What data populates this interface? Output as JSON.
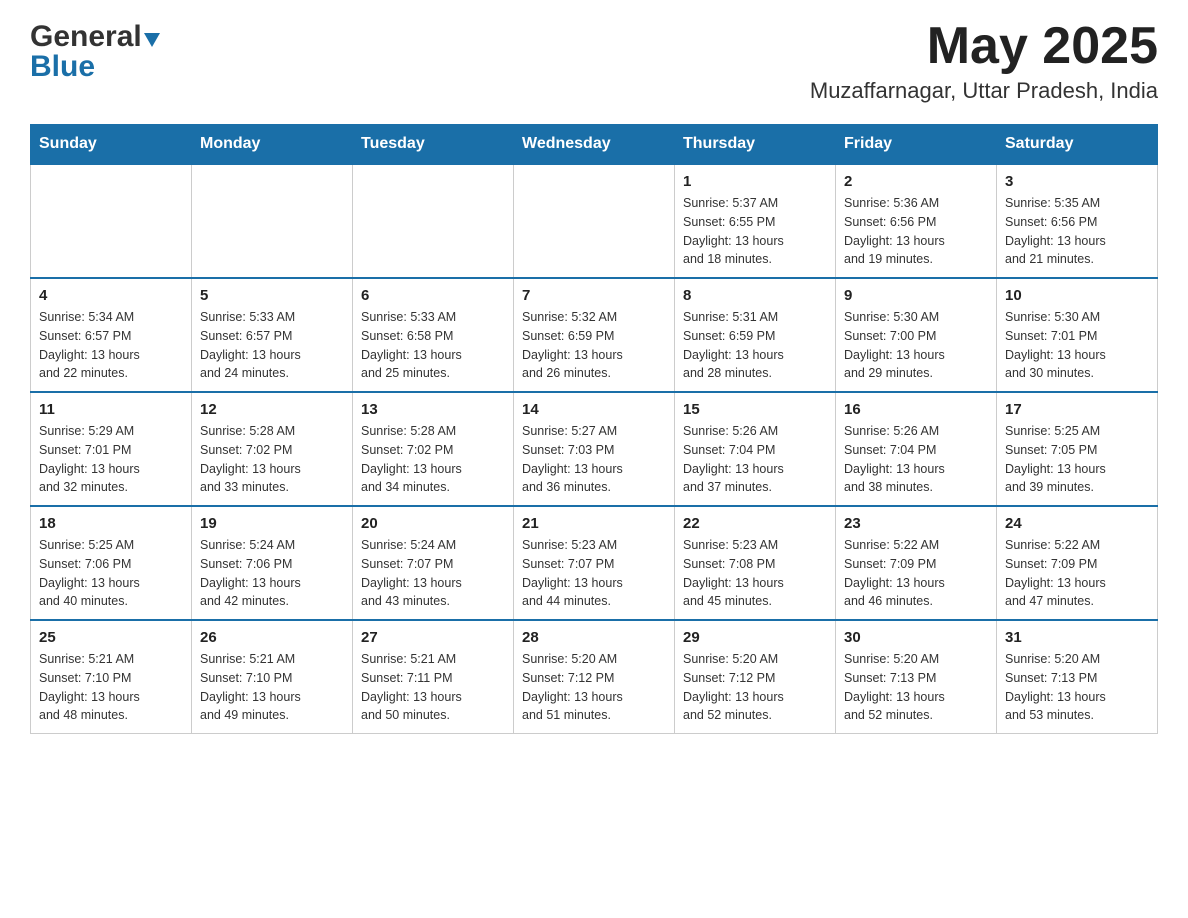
{
  "header": {
    "logo_general": "General",
    "logo_blue": "Blue",
    "month_year": "May 2025",
    "location": "Muzaffarnagar, Uttar Pradesh, India"
  },
  "days_of_week": [
    "Sunday",
    "Monday",
    "Tuesday",
    "Wednesday",
    "Thursday",
    "Friday",
    "Saturday"
  ],
  "weeks": [
    [
      {
        "day": "",
        "info": ""
      },
      {
        "day": "",
        "info": ""
      },
      {
        "day": "",
        "info": ""
      },
      {
        "day": "",
        "info": ""
      },
      {
        "day": "1",
        "info": "Sunrise: 5:37 AM\nSunset: 6:55 PM\nDaylight: 13 hours\nand 18 minutes."
      },
      {
        "day": "2",
        "info": "Sunrise: 5:36 AM\nSunset: 6:56 PM\nDaylight: 13 hours\nand 19 minutes."
      },
      {
        "day": "3",
        "info": "Sunrise: 5:35 AM\nSunset: 6:56 PM\nDaylight: 13 hours\nand 21 minutes."
      }
    ],
    [
      {
        "day": "4",
        "info": "Sunrise: 5:34 AM\nSunset: 6:57 PM\nDaylight: 13 hours\nand 22 minutes."
      },
      {
        "day": "5",
        "info": "Sunrise: 5:33 AM\nSunset: 6:57 PM\nDaylight: 13 hours\nand 24 minutes."
      },
      {
        "day": "6",
        "info": "Sunrise: 5:33 AM\nSunset: 6:58 PM\nDaylight: 13 hours\nand 25 minutes."
      },
      {
        "day": "7",
        "info": "Sunrise: 5:32 AM\nSunset: 6:59 PM\nDaylight: 13 hours\nand 26 minutes."
      },
      {
        "day": "8",
        "info": "Sunrise: 5:31 AM\nSunset: 6:59 PM\nDaylight: 13 hours\nand 28 minutes."
      },
      {
        "day": "9",
        "info": "Sunrise: 5:30 AM\nSunset: 7:00 PM\nDaylight: 13 hours\nand 29 minutes."
      },
      {
        "day": "10",
        "info": "Sunrise: 5:30 AM\nSunset: 7:01 PM\nDaylight: 13 hours\nand 30 minutes."
      }
    ],
    [
      {
        "day": "11",
        "info": "Sunrise: 5:29 AM\nSunset: 7:01 PM\nDaylight: 13 hours\nand 32 minutes."
      },
      {
        "day": "12",
        "info": "Sunrise: 5:28 AM\nSunset: 7:02 PM\nDaylight: 13 hours\nand 33 minutes."
      },
      {
        "day": "13",
        "info": "Sunrise: 5:28 AM\nSunset: 7:02 PM\nDaylight: 13 hours\nand 34 minutes."
      },
      {
        "day": "14",
        "info": "Sunrise: 5:27 AM\nSunset: 7:03 PM\nDaylight: 13 hours\nand 36 minutes."
      },
      {
        "day": "15",
        "info": "Sunrise: 5:26 AM\nSunset: 7:04 PM\nDaylight: 13 hours\nand 37 minutes."
      },
      {
        "day": "16",
        "info": "Sunrise: 5:26 AM\nSunset: 7:04 PM\nDaylight: 13 hours\nand 38 minutes."
      },
      {
        "day": "17",
        "info": "Sunrise: 5:25 AM\nSunset: 7:05 PM\nDaylight: 13 hours\nand 39 minutes."
      }
    ],
    [
      {
        "day": "18",
        "info": "Sunrise: 5:25 AM\nSunset: 7:06 PM\nDaylight: 13 hours\nand 40 minutes."
      },
      {
        "day": "19",
        "info": "Sunrise: 5:24 AM\nSunset: 7:06 PM\nDaylight: 13 hours\nand 42 minutes."
      },
      {
        "day": "20",
        "info": "Sunrise: 5:24 AM\nSunset: 7:07 PM\nDaylight: 13 hours\nand 43 minutes."
      },
      {
        "day": "21",
        "info": "Sunrise: 5:23 AM\nSunset: 7:07 PM\nDaylight: 13 hours\nand 44 minutes."
      },
      {
        "day": "22",
        "info": "Sunrise: 5:23 AM\nSunset: 7:08 PM\nDaylight: 13 hours\nand 45 minutes."
      },
      {
        "day": "23",
        "info": "Sunrise: 5:22 AM\nSunset: 7:09 PM\nDaylight: 13 hours\nand 46 minutes."
      },
      {
        "day": "24",
        "info": "Sunrise: 5:22 AM\nSunset: 7:09 PM\nDaylight: 13 hours\nand 47 minutes."
      }
    ],
    [
      {
        "day": "25",
        "info": "Sunrise: 5:21 AM\nSunset: 7:10 PM\nDaylight: 13 hours\nand 48 minutes."
      },
      {
        "day": "26",
        "info": "Sunrise: 5:21 AM\nSunset: 7:10 PM\nDaylight: 13 hours\nand 49 minutes."
      },
      {
        "day": "27",
        "info": "Sunrise: 5:21 AM\nSunset: 7:11 PM\nDaylight: 13 hours\nand 50 minutes."
      },
      {
        "day": "28",
        "info": "Sunrise: 5:20 AM\nSunset: 7:12 PM\nDaylight: 13 hours\nand 51 minutes."
      },
      {
        "day": "29",
        "info": "Sunrise: 5:20 AM\nSunset: 7:12 PM\nDaylight: 13 hours\nand 52 minutes."
      },
      {
        "day": "30",
        "info": "Sunrise: 5:20 AM\nSunset: 7:13 PM\nDaylight: 13 hours\nand 52 minutes."
      },
      {
        "day": "31",
        "info": "Sunrise: 5:20 AM\nSunset: 7:13 PM\nDaylight: 13 hours\nand 53 minutes."
      }
    ]
  ]
}
